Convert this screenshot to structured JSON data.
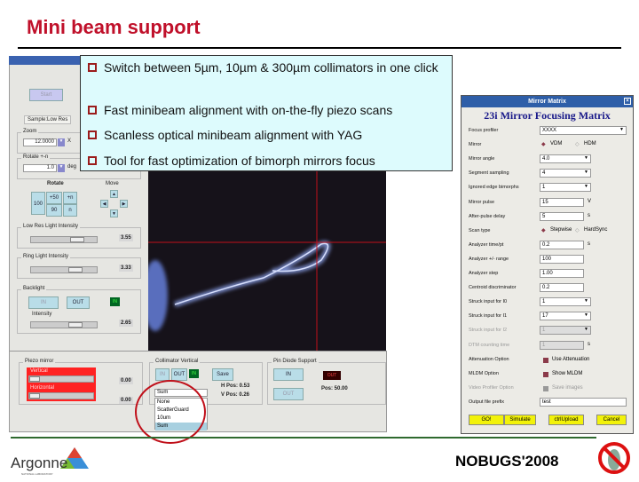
{
  "slide": {
    "title": "Mini beam support",
    "footer": "NOBUGS'2008",
    "logo_text": "Argonne",
    "logo_sub": "NATIONAL LABORATORY"
  },
  "bullets": [
    "Switch between 5µm, 10µm & 300µm collimators in one click",
    "Fast minibeam alignment with on-the-fly piezo scans",
    "Scanless optical minibeam alignment with YAG",
    "Tool for fast optimization of bimorph mirrors focus"
  ],
  "left_app": {
    "start": "Start",
    "tab": "Sample:Low Res",
    "zoom_label": "Zoom",
    "zoom_value": "12.0000",
    "zoom_unit": "X",
    "rotate_label": "Rotate +-n",
    "rotate_value": "1.0",
    "rotate_unit": "deg",
    "rotate_title": "Rotate",
    "move_title": "Move",
    "rot_buttons": [
      "100",
      "+50",
      "+n",
      "90",
      "n"
    ],
    "low_res": {
      "label": "Low Res Light Intensity",
      "value": "3.55"
    },
    "ring": {
      "label": "Ring Light Intensity",
      "value": "3.33"
    },
    "backlight": {
      "label": "Backlight",
      "in": "IN",
      "out": "OUT",
      "led": "IN",
      "intensity_label": "Intensity",
      "value": "2.65"
    },
    "piezo": {
      "label": "Piezo mirror",
      "vertical": "Vertical",
      "horizontal": "Horizontal",
      "v_value": "0.00",
      "h_value": "0.00"
    },
    "collimator": {
      "label": "Collimator Vertical",
      "in": "IN",
      "out": "OUT",
      "led": "IN",
      "save": "Save",
      "h_pos": "H Pos:  0.53",
      "v_pos": "V Pos:  0.26",
      "selected": "Sum",
      "options": [
        "None",
        "ScatterGuard",
        "10um",
        "Sum"
      ]
    },
    "pin_diode": {
      "label": "Pin Diode Support",
      "in": "IN",
      "out": "OUT",
      "led": "OUT",
      "pos": "Pos: 50.00"
    }
  },
  "dialog": {
    "window_title": "Mirror Matrix",
    "heading": "23i Mirror Focusing Matrix",
    "rows": [
      {
        "label": "Focus profiler",
        "value": "XXXX",
        "unit": ""
      },
      {
        "label": "Mirror",
        "value": "",
        "unit": ""
      },
      {
        "label": "Mirror angle",
        "value": "4.0",
        "unit": ""
      },
      {
        "label": "Segment sampling",
        "value": "4",
        "unit": ""
      },
      {
        "label": "Ignored edge bimorphs",
        "value": "1",
        "unit": ""
      },
      {
        "label": "Mirror pulse",
        "value": "15",
        "unit": "V"
      },
      {
        "label": "After-pulse delay",
        "value": "5",
        "unit": "s"
      },
      {
        "label": "Scan type",
        "value": "",
        "unit": ""
      },
      {
        "label": "Analyzer time/pt",
        "value": "0.2",
        "unit": "s"
      },
      {
        "label": "Analyzer +/- range",
        "value": "100",
        "unit": ""
      },
      {
        "label": "Analyzer step",
        "value": "1.00",
        "unit": ""
      },
      {
        "label": "Centroid discriminator",
        "value": "0.2",
        "unit": ""
      },
      {
        "label": "Struck input for I0",
        "value": "1",
        "unit": ""
      },
      {
        "label": "Struck input for I1",
        "value": "17",
        "unit": ""
      },
      {
        "label": "Struck input for I2",
        "value": "1",
        "unit": ""
      },
      {
        "label": "DTM counting time",
        "value": "1",
        "unit": "s"
      },
      {
        "label": "Attenuation Option",
        "value": "Use Attenuation",
        "unit": ""
      },
      {
        "label": "MLDM Option",
        "value": "Show MLDM",
        "unit": ""
      },
      {
        "label": "Video Profiler Option",
        "value": "Save images",
        "unit": ""
      },
      {
        "label": "Output file prefix",
        "value": "test",
        "unit": ""
      }
    ],
    "mirror_options": [
      "VDM",
      "HDM"
    ],
    "scan_options": [
      "Stepwise",
      "HardSync"
    ],
    "buttons": [
      "GO!",
      "Simulate",
      "ctrlUpload",
      "Cancel"
    ]
  },
  "colors": {
    "title": "#c0102a",
    "callout": "#ddfbfd",
    "yellow_button": "#f2f20a",
    "crosshair": "#c0101a"
  }
}
